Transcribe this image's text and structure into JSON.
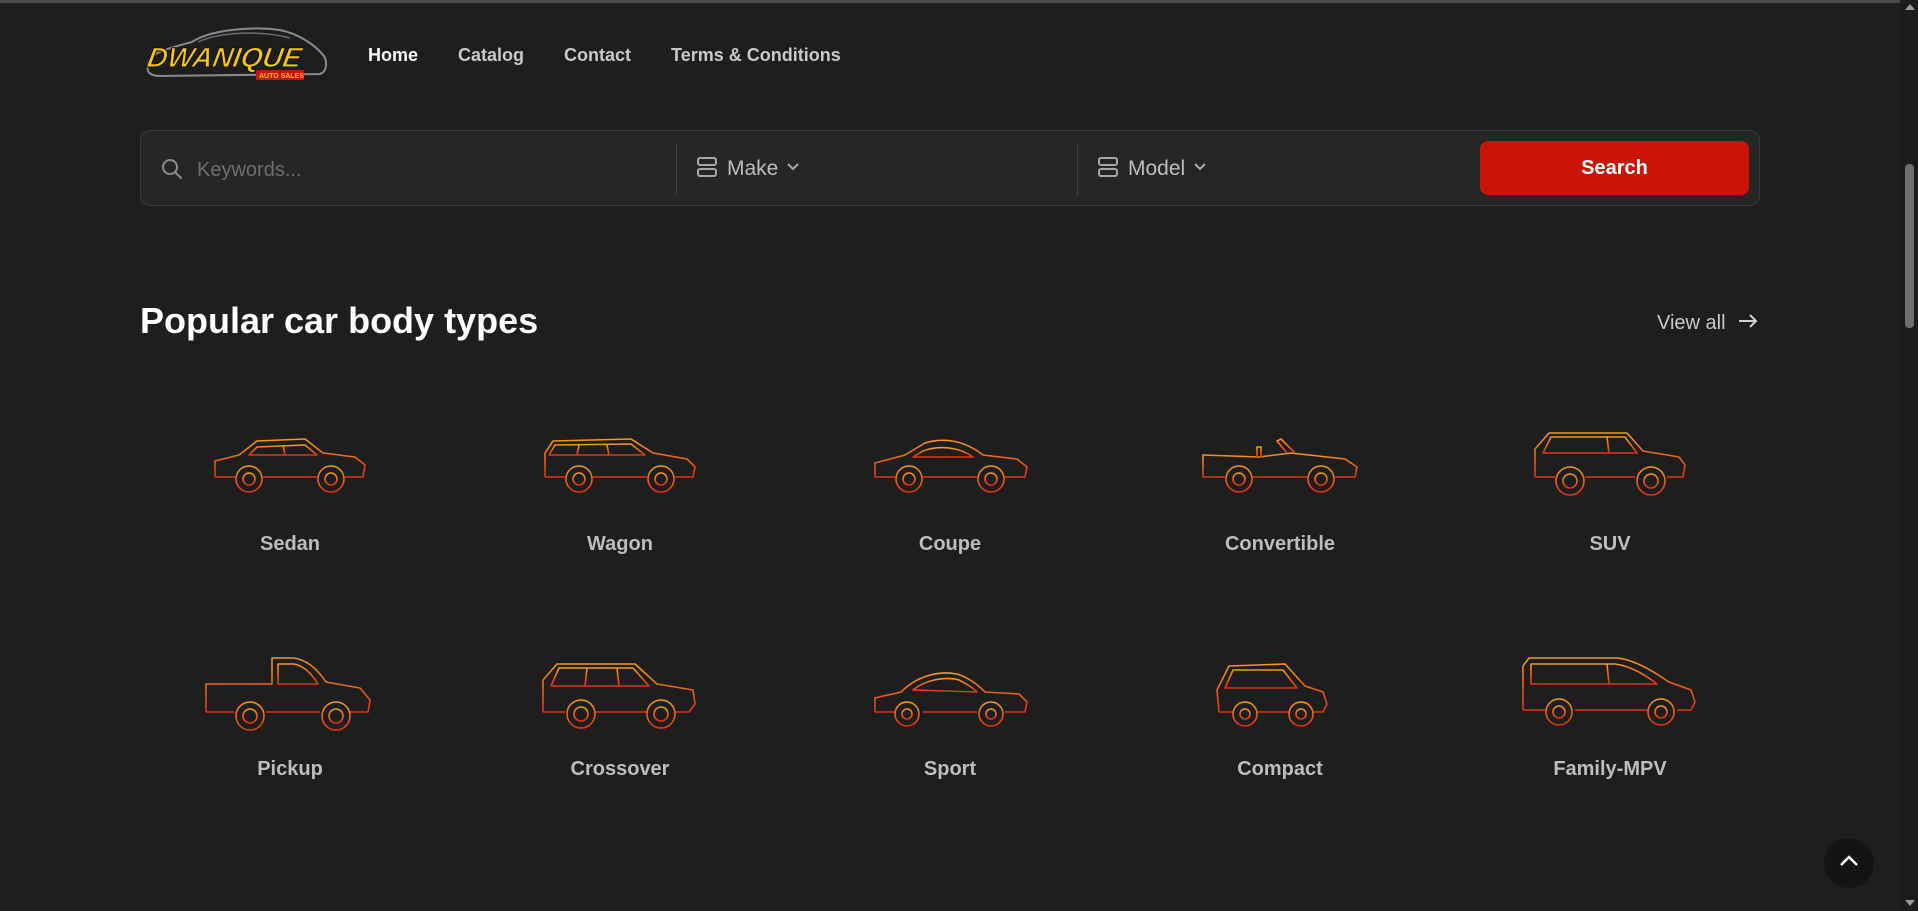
{
  "brand": {
    "logo_text": "DWANIQUE",
    "logo_subtext": "AUTO SALES",
    "accent": "#c9140a",
    "logo_yellow": "#f5c518"
  },
  "nav": [
    {
      "label": "Home",
      "active": true
    },
    {
      "label": "Catalog",
      "active": false
    },
    {
      "label": "Contact",
      "active": false
    },
    {
      "label": "Terms & Conditions",
      "active": false
    }
  ],
  "search": {
    "placeholder": "Keywords...",
    "make_label": "Make",
    "model_label": "Model",
    "button_label": "Search"
  },
  "section": {
    "title": "Popular car body types",
    "view_all": "View all"
  },
  "body_types": [
    {
      "label": "Sedan",
      "icon": "sedan-icon"
    },
    {
      "label": "Wagon",
      "icon": "wagon-icon"
    },
    {
      "label": "Coupe",
      "icon": "coupe-icon"
    },
    {
      "label": "Convertible",
      "icon": "convertible-icon"
    },
    {
      "label": "SUV",
      "icon": "suv-icon"
    },
    {
      "label": "Pickup",
      "icon": "pickup-icon"
    },
    {
      "label": "Crossover",
      "icon": "crossover-icon"
    },
    {
      "label": "Sport",
      "icon": "sport-icon"
    },
    {
      "label": "Compact",
      "icon": "compact-icon"
    },
    {
      "label": "Family-MPV",
      "icon": "family-mpv-icon"
    }
  ]
}
